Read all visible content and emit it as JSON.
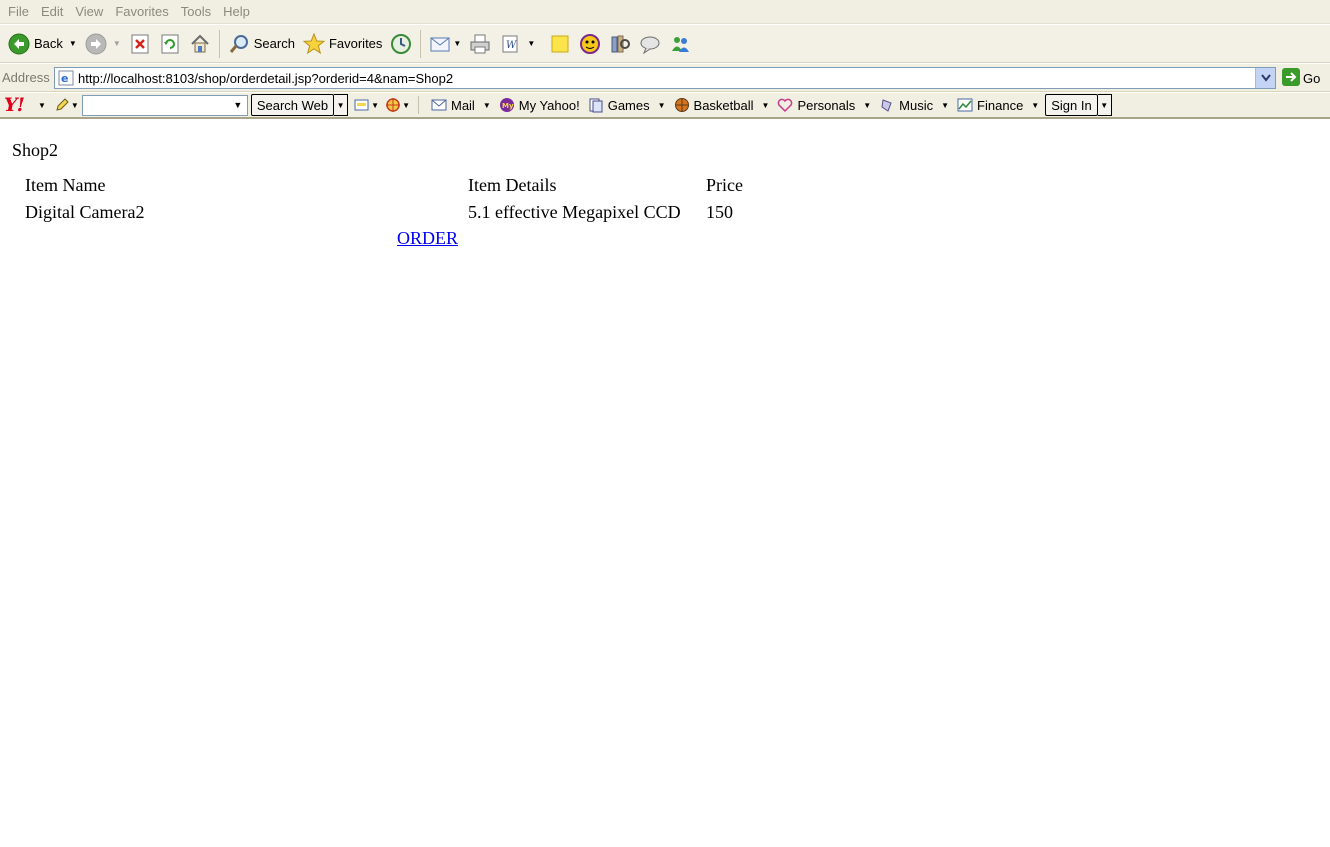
{
  "menu": [
    "File",
    "Edit",
    "View",
    "Favorites",
    "Tools",
    "Help"
  ],
  "toolbar": {
    "back_label": "Back",
    "search_label": "Search",
    "favorites_label": "Favorites"
  },
  "address": {
    "label": "Address",
    "url": "http://localhost:8103/shop/orderdetail.jsp?orderid=4&nam=Shop2",
    "go_label": "Go"
  },
  "yahoo": {
    "logo": "Y!",
    "search_placeholder": "",
    "search_button": "Search Web",
    "items": [
      "Mail",
      "My Yahoo!",
      "Games",
      "Basketball",
      "Personals",
      "Music",
      "Finance"
    ],
    "sign_in": "Sign In"
  },
  "page": {
    "shop_name": "Shop2",
    "headers": [
      "Item Name",
      "Item Details",
      "Price"
    ],
    "rows": [
      [
        "Digital Camera2",
        "5.1 effective Megapixel CCD",
        "150"
      ]
    ],
    "order_link": "ORDER"
  },
  "colors": {
    "link": "#0000ee",
    "chrome": "#f1efe2",
    "yahoo_red": "#e0001b"
  }
}
